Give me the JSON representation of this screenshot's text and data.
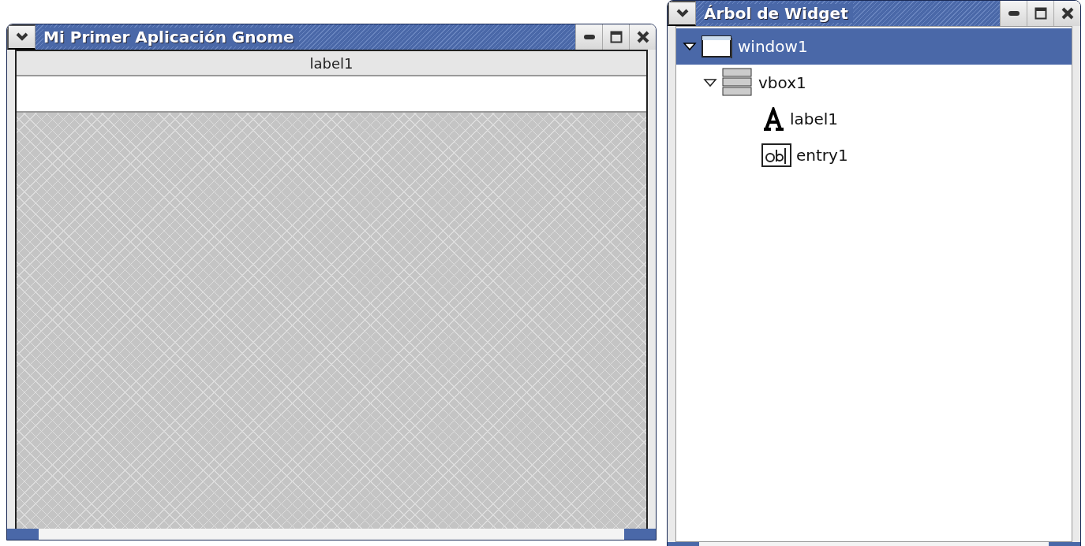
{
  "app_window": {
    "title": "Mi Primer Aplicación Gnome",
    "label": "label1"
  },
  "tree_window": {
    "title": "Árbol de Widget",
    "tree": [
      {
        "label": "window1",
        "kind": "window",
        "selected": true,
        "expanded": true,
        "children": [
          {
            "label": "vbox1",
            "kind": "vbox",
            "selected": false,
            "expanded": true,
            "children": [
              {
                "label": "label1",
                "kind": "label",
                "selected": false
              },
              {
                "label": "entry1",
                "kind": "entry",
                "selected": false
              }
            ]
          }
        ]
      }
    ]
  }
}
